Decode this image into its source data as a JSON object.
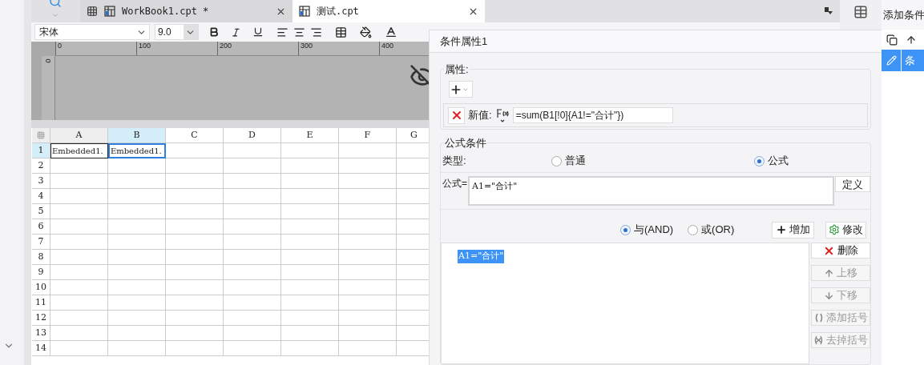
{
  "tabs": [
    {
      "label": "WorkBook1.cpt *",
      "selected": false
    },
    {
      "label": "测试.cpt",
      "selected": true
    }
  ],
  "toolbar": {
    "font": "宋体",
    "size": "9.0"
  },
  "ruler": {
    "ticks": [
      "0",
      "100",
      "200",
      "300",
      "400"
    ],
    "side_tick": "0"
  },
  "sheet": {
    "columns": [
      {
        "label": "A",
        "selected": false
      },
      {
        "label": "B",
        "selected": true
      },
      {
        "label": "C",
        "selected": false
      },
      {
        "label": "D",
        "selected": false
      },
      {
        "label": "E",
        "selected": false
      },
      {
        "label": "F",
        "selected": false
      },
      {
        "label": "G",
        "selected": false
      }
    ],
    "rows": [
      {
        "label": "1",
        "selected": true,
        "cells": [
          {
            "text": "Embedded1.",
            "selected": false
          },
          {
            "text": "Embedded1.",
            "selected": true
          }
        ]
      },
      {
        "label": "2",
        "selected": false
      },
      {
        "label": "3",
        "selected": false
      },
      {
        "label": "4",
        "selected": false
      },
      {
        "label": "5",
        "selected": false
      },
      {
        "label": "6",
        "selected": false
      },
      {
        "label": "7",
        "selected": false
      },
      {
        "label": "8",
        "selected": false
      },
      {
        "label": "9",
        "selected": false
      },
      {
        "label": "10",
        "selected": false
      },
      {
        "label": "11",
        "selected": false
      },
      {
        "label": "12",
        "selected": false
      },
      {
        "label": "13",
        "selected": false
      },
      {
        "label": "14",
        "selected": false
      }
    ]
  },
  "dialog": {
    "title": "条件属性1",
    "attributes": {
      "legend": "属性:",
      "new_value_label": "新值:",
      "formula": "=sum(B1[!0]{A1!=\"合计\"})"
    },
    "formula_condition": {
      "legend": "公式条件",
      "type_label": "类型:",
      "types": [
        {
          "label": "普通",
          "selected": false
        },
        {
          "label": "公式",
          "selected": true
        }
      ],
      "formula_label": "公式=",
      "formula": "A1=\"合计\"",
      "define_button": "定义",
      "logic": [
        {
          "label": "与(AND)",
          "selected": true
        },
        {
          "label": "或(OR)",
          "selected": false
        }
      ],
      "add_button": "增加",
      "modify_button": "修改",
      "conditions": [
        {
          "text": "A1=\"合计\"",
          "selected": true
        }
      ],
      "side_buttons": [
        {
          "kind": "delete",
          "label": "删除",
          "disabled": false
        },
        {
          "kind": "up",
          "label": "上移",
          "disabled": true
        },
        {
          "kind": "down",
          "label": "下移",
          "disabled": true
        },
        {
          "kind": "add-paren",
          "label": "添加括号",
          "disabled": true
        },
        {
          "kind": "remove-paren",
          "label": "去掉括号",
          "disabled": true
        }
      ]
    }
  },
  "right_panel": {
    "title": "添加条件",
    "items": [
      {
        "label": "条",
        "selected": true
      }
    ]
  }
}
